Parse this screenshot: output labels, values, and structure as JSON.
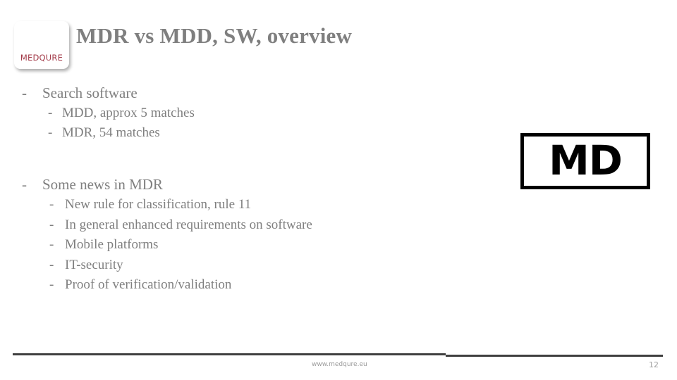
{
  "slide": {
    "title": "MDR vs MDD, SW, overview",
    "background_color": "#ffffff",
    "text_color": "#7f7f7f"
  },
  "logo": {
    "name": "MEDQURE",
    "color": "#a33b49"
  },
  "content": {
    "groups": [
      {
        "heading": {
          "dash": "-",
          "label": "Search software"
        },
        "items": [
          {
            "dash": "-",
            "label": "MDD, approx 5 matches"
          },
          {
            "dash": "-",
            "label": "MDR, 54 matches"
          }
        ]
      },
      {
        "heading": {
          "dash": "-",
          "label": "Some news in MDR"
        },
        "items": [
          {
            "dash": "-",
            "label": "New rule for classification, rule 11"
          },
          {
            "dash": "-",
            "label": "In general enhanced requirements on software"
          },
          {
            "dash": "-",
            "label": "Mobile platforms"
          },
          {
            "dash": "-",
            "label": "IT-security"
          },
          {
            "dash": "-",
            "label": "Proof of verification/validation"
          }
        ]
      }
    ]
  },
  "md_symbol": {
    "label": "MD",
    "border_color": "#000000"
  },
  "footer": {
    "url": "www.medqure.eu",
    "page_number": "12",
    "rule_color": "#3f3f3f"
  }
}
